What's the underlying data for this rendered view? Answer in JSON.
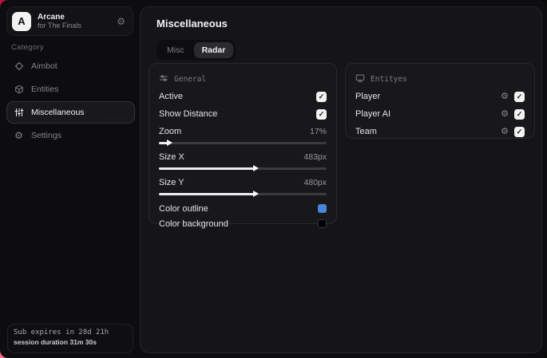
{
  "colors": {
    "accent_red": "#e22253",
    "outline_swatch": "#4a86d8",
    "background_swatch": "#000000",
    "checkbox_bg": "#f2f2f3"
  },
  "icons": {
    "check_glyph": "✓",
    "gear_glyph": "⚙",
    "dots_texture": "·······"
  },
  "sidebar": {
    "app": {
      "initial": "A",
      "name": "Arcane",
      "subtitle": "for The Finals"
    },
    "category_label": "Category",
    "items": [
      {
        "label": "Aimbot",
        "icon": "crosshair-icon",
        "active": false
      },
      {
        "label": "Entities",
        "icon": "entities-icon",
        "active": false
      },
      {
        "label": "Miscellaneous",
        "icon": "sliders-icon",
        "active": true
      },
      {
        "label": "Settings",
        "icon": "gear-icon",
        "active": false
      }
    ],
    "footer": {
      "line1": "Sub expires in 28d 21h",
      "line2": "session duration 31m 30s"
    }
  },
  "main": {
    "title": "Miscellaneous",
    "tabs": [
      {
        "label": "Misc",
        "active": false
      },
      {
        "label": "Radar",
        "active": true
      }
    ],
    "general_card": {
      "header": "General",
      "rows": [
        {
          "type": "checkbox",
          "label": "Active",
          "checked": true
        },
        {
          "type": "checkbox",
          "label": "Show Distance",
          "checked": true
        },
        {
          "type": "slider",
          "label": "Zoom",
          "value": "17%",
          "fill": "5.5%"
        },
        {
          "type": "slider",
          "label": "Size X",
          "value": "483px",
          "fill": "57%"
        },
        {
          "type": "slider",
          "label": "Size Y",
          "value": "480px",
          "fill": "57%"
        },
        {
          "type": "color",
          "label": "Color outline",
          "color": "#4a86d8"
        },
        {
          "type": "color",
          "label": "Color background",
          "color": "#000000"
        }
      ]
    },
    "entities_card": {
      "header": "Entityes",
      "rows": [
        {
          "label": "Player",
          "checked": true
        },
        {
          "label": "Player AI",
          "checked": true
        },
        {
          "label": "Team",
          "checked": true
        }
      ]
    }
  }
}
